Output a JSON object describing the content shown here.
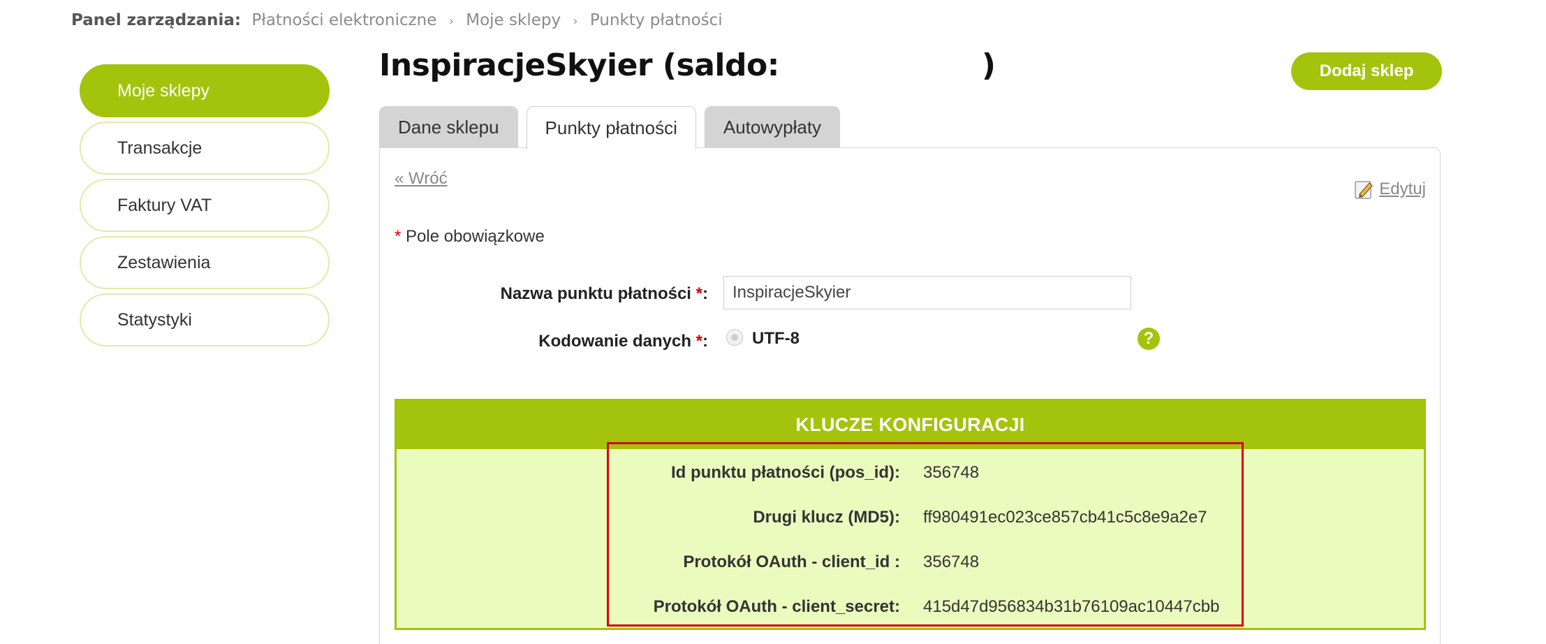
{
  "breadcrumb": {
    "head": "Panel zarządzania:",
    "items": [
      "Płatności elektroniczne",
      "Moje sklepy",
      "Punkty płatności"
    ],
    "separator": "›"
  },
  "sidebar": {
    "items": [
      {
        "label": "Moje sklepy",
        "active": true
      },
      {
        "label": "Transakcje",
        "active": false
      },
      {
        "label": "Faktury VAT",
        "active": false
      },
      {
        "label": "Zestawienia",
        "active": false
      },
      {
        "label": "Statystyki",
        "active": false
      }
    ]
  },
  "header": {
    "title_prefix": "InspiracjeSkyier (saldo:",
    "title_suffix": ")",
    "add_shop_label": "Dodaj sklep"
  },
  "tabs": [
    {
      "label": "Dane sklepu",
      "active": false
    },
    {
      "label": "Punkty płatności",
      "active": true
    },
    {
      "label": "Autowypłaty",
      "active": false
    }
  ],
  "panel": {
    "back_label": "« Wróć",
    "edit_label": "Edytuj",
    "required_star": "*",
    "required_note": "Pole obowiązkowe"
  },
  "form": {
    "name_label": "Nazwa punktu płatności",
    "name_value": "InspiracjeSkyier",
    "encoding_label": "Kodowanie danych",
    "encoding_option": "UTF-8",
    "label_suffix": ":",
    "help_symbol": "?"
  },
  "keys": {
    "header": "KLUCZE KONFIGURACJI",
    "rows": [
      {
        "label": "Id punktu płatności (pos_id):",
        "value": "356748"
      },
      {
        "label": "Drugi klucz (MD5):",
        "value": "ff980491ec023ce857cb41c5c8e9a2e7"
      },
      {
        "label": "Protokół OAuth - client_id :",
        "value": "356748"
      },
      {
        "label": "Protokół OAuth - client_secret:",
        "value": "415d47d956834b31b76109ac10447cbb"
      }
    ]
  },
  "colors": {
    "accent": "#a3c30d",
    "keys_background": "#ebfbbe",
    "highlight": "#d90000"
  }
}
